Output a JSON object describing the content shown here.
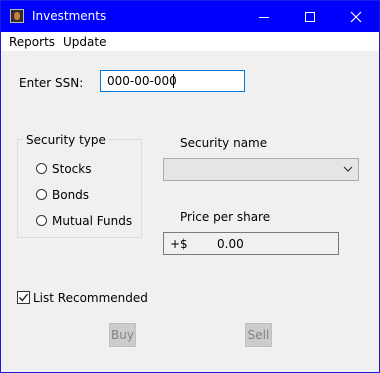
{
  "window": {
    "title": "Investments",
    "accent": "#0000ff"
  },
  "menu": {
    "items": [
      {
        "label": "Reports"
      },
      {
        "label": "Update"
      }
    ]
  },
  "form": {
    "ssn_label": "Enter SSN:",
    "ssn_value": "000-00-000",
    "security_type_legend": "Security type",
    "security_types": [
      {
        "label": "Stocks",
        "selected": false
      },
      {
        "label": "Bonds",
        "selected": false
      },
      {
        "label": "Mutual Funds",
        "selected": false
      }
    ],
    "security_name_label": "Security name",
    "security_name_value": "",
    "price_label": "Price per share",
    "price_prefix": "+$",
    "price_value": "0.00",
    "list_recommended_label": "List Recommended",
    "list_recommended_checked": true,
    "buy_label": "Buy",
    "sell_label": "Sell"
  },
  "icons": {
    "app": "app-icon",
    "minimize": "minimize-icon",
    "maximize": "maximize-icon",
    "close": "close-icon",
    "dropdown": "chevron-down-icon",
    "check": "checkmark-icon"
  }
}
